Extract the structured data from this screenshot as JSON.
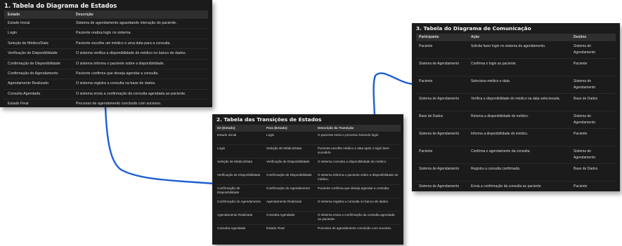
{
  "states_table": {
    "title": "1. Tabela do Diagrama de Estados",
    "headers": [
      "Estado",
      "Descrição"
    ],
    "rows": [
      [
        "Estado Inicial",
        "Sistema de agendamento aguardando interação do paciente."
      ],
      [
        "Login",
        "Paciente realiza login no sistema."
      ],
      [
        "Seleção de Médico/Data",
        "Paciente escolhe um médico e uma data para a consulta."
      ],
      [
        "Verificação de Disponibilidade",
        "O sistema verifica a disponibilidade do médico no banco de dados."
      ],
      [
        "Confirmação de Disponibilidade",
        "O sistema informa o paciente sobre a disponibilidade."
      ],
      [
        "Confirmação do Agendamento",
        "Paciente confirma que deseja agendar a consulta."
      ],
      [
        "Agendamento Realizado",
        "O sistema registra a consulta na base de dados."
      ],
      [
        "Consulta Agendada",
        "O sistema envia a confirmação da consulta agendada ao paciente."
      ],
      [
        "Estado Final",
        "Processo de agendamento concluído com sucesso."
      ]
    ]
  },
  "transitions_table": {
    "title": "2. Tabela das Transições de Estados",
    "headers": [
      "De (Estado)",
      "Para (Estado)",
      "Descrição da Transição"
    ],
    "rows": [
      [
        "Estado Inicial",
        "Login",
        "O paciente inicia o processo fazendo login."
      ],
      [
        "Login",
        "Seleção de Médico/Data",
        "Paciente escolhe médico e data após o login bem-sucedido."
      ],
      [
        "Seleção de Médico/Data",
        "Verificação de Disponibilidade",
        "O sistema consulta a disponibilidade do médico."
      ],
      [
        "Verificação de Disponibilidade",
        "Confirmação de Disponibilidade",
        "O sistema informa o paciente sobre a disponibilidade do médico."
      ],
      [
        "Confirmação de Disponibilidade",
        "Confirmação do Agendamento",
        "Paciente confirma que deseja agendar a consulta."
      ],
      [
        "Confirmação do Agendamento",
        "Agendamento Realizado",
        "O sistema registra a consulta no banco de dados."
      ],
      [
        "Agendamento Realizado",
        "Consulta Agendada",
        "O sistema envia a confirmação da consulta agendada ao paciente."
      ],
      [
        "Consulta Agendada",
        "Estado Final",
        "Processo de agendamento concluído com sucesso."
      ]
    ]
  },
  "communication_table": {
    "title": "3. Tabela do Diagrama de Comunicação",
    "headers": [
      "Participante",
      "Ação",
      "Destino"
    ],
    "rows": [
      [
        "Paciente",
        "Solicita fazer login no sistema de agendamento.",
        "Sistema de Agendamento"
      ],
      [
        "Sistema de Agendamento",
        "Confirma o login ao paciente.",
        "Paciente"
      ],
      [
        "Paciente",
        "Seleciona médico e data.",
        "Sistema de Agendamento"
      ],
      [
        "Sistema de Agendamento",
        "Verifica a disponibilidade do médico na data selecionada.",
        "Base de Dados"
      ],
      [
        "Base de Dados",
        "Retorna a disponibilidade do médico.",
        "Sistema de Agendamento"
      ],
      [
        "Sistema de Agendamento",
        "Informa a disponibilidade do médico.",
        "Paciente"
      ],
      [
        "Paciente",
        "Confirma o agendamento da consulta.",
        "Sistema de Agendamento"
      ],
      [
        "Sistema de Agendamento",
        "Registra a consulta confirmada.",
        "Base de Dados"
      ],
      [
        "Sistema de Agendamento",
        "Envia a confirmação da consulta ao paciente.",
        "Paciente"
      ]
    ]
  },
  "colors": {
    "panel_bg": "#1b1b1b",
    "header_bg": "#2f2f2f",
    "connector": "#1e5fd0"
  }
}
